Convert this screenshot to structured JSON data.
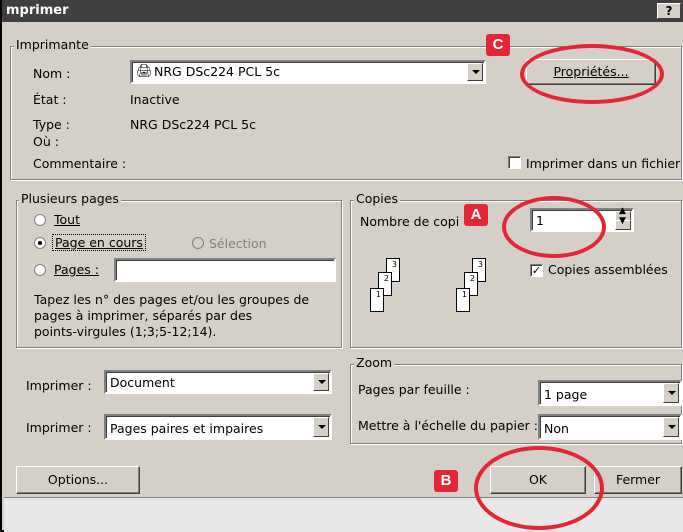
{
  "window": {
    "title": "mprimer",
    "help_label": "?"
  },
  "printer": {
    "legend": "Imprimante",
    "name_label": "Nom :",
    "name_value": "NRG DSc224 PCL 5c",
    "state_label": "État :",
    "state_value": "Inactive",
    "type_label": "Type :",
    "type_value": "NRG DSc224 PCL 5c",
    "where_label": "Où :",
    "comment_label": "Commentaire :",
    "properties_label": "Propriétés...",
    "print_to_file_label": "Imprimer dans un fichier",
    "print_to_file_checked": false
  },
  "pages": {
    "legend": "Plusieurs pages",
    "all_label": "Tout",
    "current_label": "Page en cours",
    "selection_label": "Sélection",
    "pages_label": "Pages :",
    "pages_value": "",
    "help_text_1": "Tapez les n° des pages et/ou les groupes de",
    "help_text_2": "pages à imprimer, séparés par des",
    "help_text_3": "points-virgules (1;3;5-12;14).",
    "selected": "current"
  },
  "copies": {
    "legend": "Copies",
    "count_label": "Nombre de copi",
    "count_value": "1",
    "collate_label": "Copies assemblées",
    "collate_checked": true,
    "page_numbers": [
      "3",
      "2",
      "1"
    ]
  },
  "print_what": {
    "label": "Imprimer :",
    "value": "Document"
  },
  "print_pages": {
    "label": "Imprimer :",
    "value": "Pages paires et impaires"
  },
  "zoom": {
    "legend": "Zoom",
    "per_sheet_label": "Pages par feuille :",
    "per_sheet_value": "1 page",
    "scale_label": "Mettre à l'échelle du papier :",
    "scale_value": "Non"
  },
  "buttons": {
    "options": "Options...",
    "ok": "OK",
    "close": "Fermer"
  },
  "annotations": {
    "a": "A",
    "b": "B",
    "c": "C",
    "color": "#e32636"
  }
}
